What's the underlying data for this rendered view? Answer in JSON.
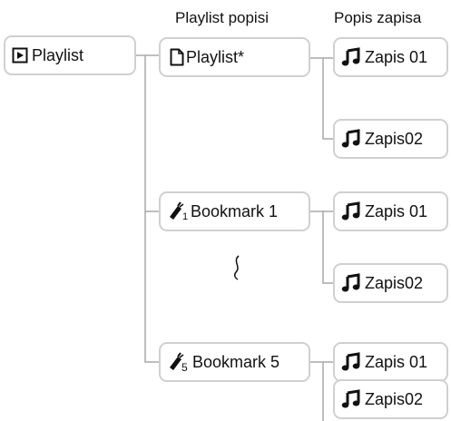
{
  "headers": {
    "playlist_lists": "Playlist popisi",
    "track_lists": "Popis zapisa"
  },
  "root": {
    "label": "Playlist",
    "icon": "playlist-play-icon"
  },
  "lists": [
    {
      "label": "Playlist*",
      "icon": "document-icon"
    },
    {
      "label": "Bookmark 1",
      "icon": "bookmark-1-icon"
    },
    {
      "label": "Bookmark 5",
      "icon": "bookmark-5-icon"
    }
  ],
  "tracks": [
    {
      "label": "Zapis 01",
      "icon": "music-note-icon"
    },
    {
      "label": "Zapis02",
      "icon": "music-note-icon"
    },
    {
      "label": "Zapis 01",
      "icon": "music-note-icon"
    },
    {
      "label": "Zapis02",
      "icon": "music-note-icon"
    },
    {
      "label": "Zapis 01",
      "icon": "music-note-icon"
    },
    {
      "label": "Zapis02",
      "icon": "music-note-icon"
    }
  ],
  "bookmark_icon_digits": [
    "1",
    "5"
  ],
  "colors": {
    "box_border": "#d0d0d0",
    "connector": "#a8a8a8"
  }
}
